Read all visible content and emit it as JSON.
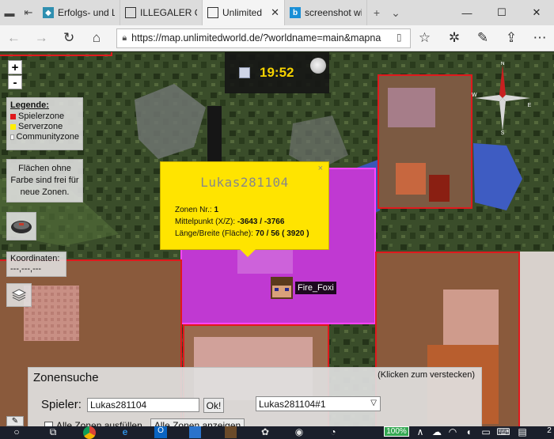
{
  "browser": {
    "tabs": [
      {
        "label": "Erfolgs- und L",
        "icon": "ulw-favicon",
        "active": false
      },
      {
        "label": "ILLEGALER CC",
        "icon": "page-icon",
        "active": false
      },
      {
        "label": "Unlimited",
        "icon": "page-icon",
        "active": true
      },
      {
        "label": "screenshot wi",
        "icon": "bing-icon",
        "active": false
      }
    ],
    "address": "https://map.unlimitedworld.de/?worldname=main&mapna"
  },
  "map": {
    "zoom_in": "+",
    "zoom_out": "-",
    "legend": {
      "title": "Legende:",
      "items": [
        {
          "label": "Spielerzone",
          "color": "#e0191d"
        },
        {
          "label": "Serverzone",
          "color": "#ffee00"
        },
        {
          "label": "Communityzone",
          "color": "#ffffff"
        }
      ]
    },
    "free_zones_note": "Flächen ohne Farbe sind frei für neue Zonen.",
    "coordinates": {
      "label": "Koordinaten:",
      "value": "---,---,---"
    },
    "time": "19:52",
    "compass": {
      "n": "N",
      "e": "E",
      "s": "S",
      "w": "W"
    },
    "popup": {
      "title": "Lukas281104",
      "close": "×",
      "zone_nr_label": "Zonen Nr.:",
      "zone_nr": "1",
      "center_label": "Mittelpunkt (X/Z):",
      "center": "-3643 / -3766",
      "size_label": "Länge/Breite (Fläche):",
      "size": "70 / 56 ( 3920 )"
    },
    "player": {
      "name": "Fire_Foxi"
    },
    "zone_search": {
      "title": "Zonensuche",
      "hide_hint": "(Klicken zum verstecken)",
      "player_label": "Spieler:",
      "player_value": "Lukas281104",
      "ok_label": "Ok!",
      "zone_select": "Lukas281104#1",
      "all_zones_label": "Alle Zonen ausfüllen",
      "show_all_label": "Alle Zonen anzeigen"
    }
  },
  "taskbar": {
    "battery": "100%",
    "clock": "2"
  }
}
